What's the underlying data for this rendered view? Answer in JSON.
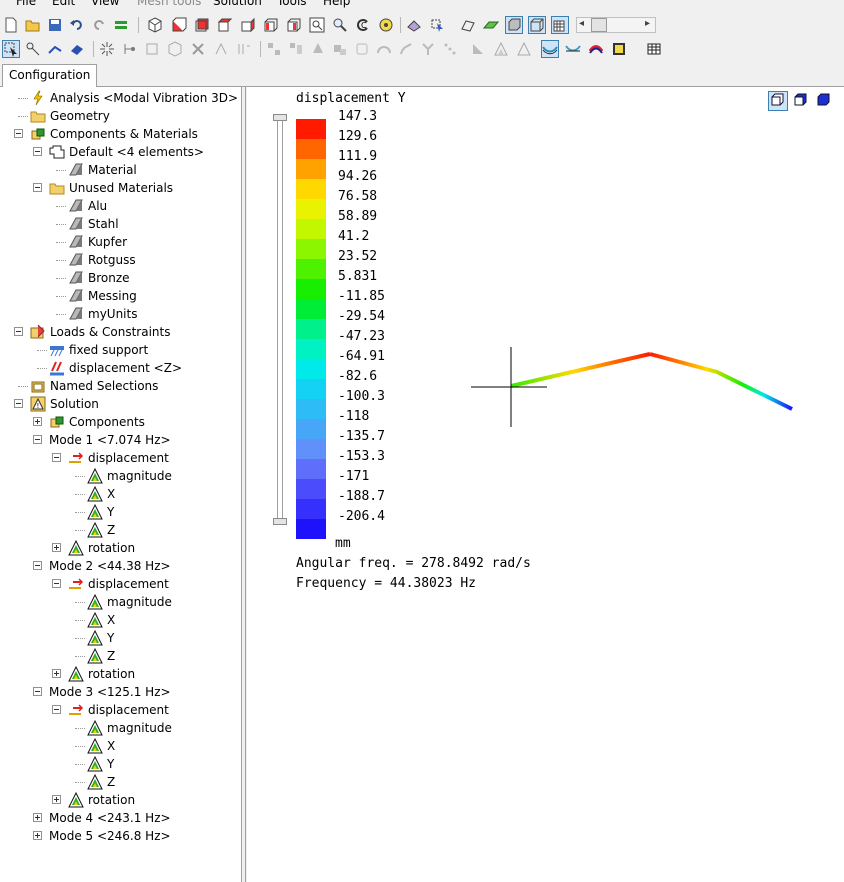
{
  "menu": [
    "File",
    "Edit",
    "View",
    "Mesh tools",
    "Solution",
    "Tools",
    "Help"
  ],
  "tab": "Configuration",
  "tree": [
    {
      "label": "Analysis <Modal Vibration 3D>",
      "icon": "lightning-icon"
    },
    {
      "label": "Geometry",
      "icon": "folder-icon"
    },
    {
      "label": "Components & Materials",
      "icon": "components-icon"
    },
    {
      "label": "Default <4 elements>",
      "icon": "part-icon"
    },
    {
      "label": "Material",
      "icon": "material-icon"
    },
    {
      "label": "Unused Materials",
      "icon": "folder-icon"
    },
    {
      "label": "Alu",
      "icon": "material-icon"
    },
    {
      "label": "Stahl",
      "icon": "material-icon"
    },
    {
      "label": "Kupfer",
      "icon": "material-icon"
    },
    {
      "label": "Rotguss",
      "icon": "material-icon"
    },
    {
      "label": "Bronze",
      "icon": "material-icon"
    },
    {
      "label": "Messing",
      "icon": "material-icon"
    },
    {
      "label": "myUnits",
      "icon": "material-icon"
    },
    {
      "label": "Loads & Constraints",
      "icon": "loads-icon"
    },
    {
      "label": "fixed support",
      "icon": "fixed-support-icon"
    },
    {
      "label": "displacement <Z>",
      "icon": "displacement-load-icon"
    },
    {
      "label": "Named Selections",
      "icon": "named-selections-icon"
    },
    {
      "label": "Solution",
      "icon": "solution-icon"
    },
    {
      "label": "Components",
      "icon": "components-icon"
    },
    {
      "label": "Mode 1 <7.074 Hz>",
      "icon": ""
    },
    {
      "label": "displacement",
      "icon": "displacement-result-icon"
    },
    {
      "label": "magnitude",
      "icon": "result-icon"
    },
    {
      "label": "X",
      "icon": "result-icon"
    },
    {
      "label": "Y",
      "icon": "result-icon"
    },
    {
      "label": "Z",
      "icon": "result-icon"
    },
    {
      "label": "rotation",
      "icon": "result-icon"
    },
    {
      "label": "Mode 2 <44.38 Hz>",
      "icon": ""
    },
    {
      "label": "displacement",
      "icon": "displacement-result-icon"
    },
    {
      "label": "magnitude",
      "icon": "result-icon"
    },
    {
      "label": "X",
      "icon": "result-icon"
    },
    {
      "label": "Y",
      "icon": "result-icon"
    },
    {
      "label": "Z",
      "icon": "result-icon"
    },
    {
      "label": "rotation",
      "icon": "result-icon"
    },
    {
      "label": "Mode 3 <125.1 Hz>",
      "icon": ""
    },
    {
      "label": "displacement",
      "icon": "displacement-result-icon"
    },
    {
      "label": "magnitude",
      "icon": "result-icon"
    },
    {
      "label": "X",
      "icon": "result-icon"
    },
    {
      "label": "Y",
      "icon": "result-icon"
    },
    {
      "label": "Z",
      "icon": "result-icon"
    },
    {
      "label": "rotation",
      "icon": "result-icon"
    },
    {
      "label": "Mode 4 <243.1 Hz>",
      "icon": ""
    },
    {
      "label": "Mode 5 <246.8 Hz>",
      "icon": ""
    }
  ],
  "legend": {
    "title": "displacement Y",
    "unit": "mm",
    "values": [
      "147.3",
      "129.6",
      "111.9",
      "94.26",
      "76.58",
      "58.89",
      "41.2",
      "23.52",
      "5.831",
      "-11.85",
      "-29.54",
      "-47.23",
      "-64.91",
      "-82.6",
      "-100.3",
      "-118",
      "-135.7",
      "-153.3",
      "-171",
      "-188.7",
      "-206.4"
    ],
    "colors": [
      "#ff1a00",
      "#ff6600",
      "#ffa200",
      "#ffd800",
      "#e9f200",
      "#c2f700",
      "#8bf600",
      "#4ef200",
      "#17ee00",
      "#00ed37",
      "#00f08c",
      "#00f2c3",
      "#00eaea",
      "#14d2f4",
      "#2ebcf6",
      "#48a6f8",
      "#6090fa",
      "#5f6efb",
      "#4b4cfb",
      "#3530fb",
      "#1d12fa"
    ]
  },
  "info": {
    "angular_freq": "Angular freq. = 278.8492 rad/s",
    "frequency": "Frequency = 44.38023 Hz"
  }
}
